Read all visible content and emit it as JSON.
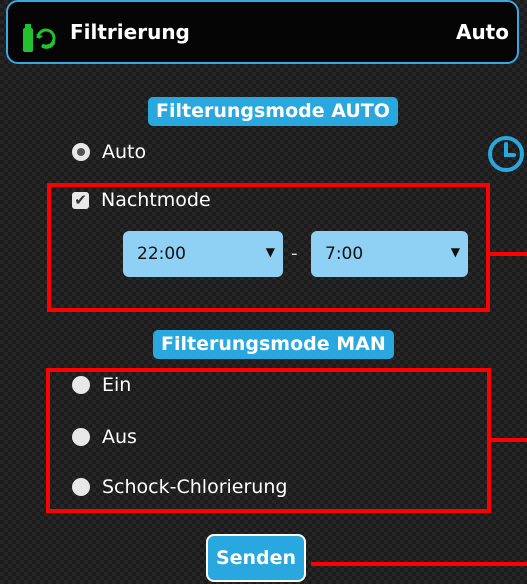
{
  "header": {
    "title": "Filtrierung",
    "status": "Auto",
    "icon": "filter-pump-refresh-icon"
  },
  "auto_section": {
    "title": "Filterungsmode AUTO",
    "auto_option": {
      "label": "Auto",
      "checked": true
    },
    "night_mode": {
      "label": "Nachtmode",
      "checked": true
    },
    "time_from": {
      "value": "22:00"
    },
    "time_separator": "-",
    "time_to": {
      "value": "7:00"
    }
  },
  "clock_icon": "clock-icon",
  "man_section": {
    "title": "Filterungsmode MAN",
    "options": [
      {
        "label": "Ein",
        "checked": false
      },
      {
        "label": "Aus",
        "checked": false
      },
      {
        "label": "Schock-Chlorierung",
        "checked": false
      }
    ]
  },
  "send_button": {
    "label": "Senden"
  },
  "colors": {
    "accent": "#29a7df",
    "select_bg": "#8fd0f5",
    "annotation_red": "#ff0000",
    "icon_green": "#22c22e"
  }
}
